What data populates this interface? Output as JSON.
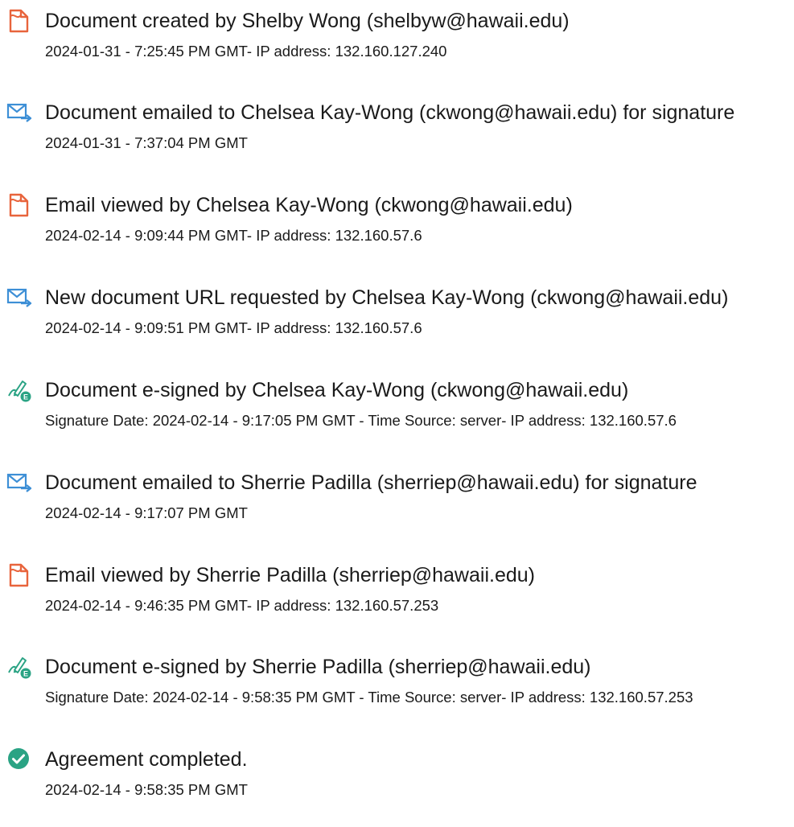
{
  "colors": {
    "doc_icon": "#e8643c",
    "email_icon": "#3d8fd6",
    "sign_icon": "#2aa384",
    "check_icon": "#2aa384",
    "text": "#1a1a1a"
  },
  "events": [
    {
      "icon": "document-icon",
      "title": "Document created by Shelby Wong (shelbyw@hawaii.edu)",
      "detail": "2024-01-31 - 7:25:45 PM GMT- IP address: 132.160.127.240"
    },
    {
      "icon": "email-sent-icon",
      "title": "Document emailed to Chelsea Kay-Wong (ckwong@hawaii.edu) for signature",
      "detail": "2024-01-31 - 7:37:04 PM GMT"
    },
    {
      "icon": "document-icon",
      "title": "Email viewed by Chelsea Kay-Wong (ckwong@hawaii.edu)",
      "detail": "2024-02-14 - 9:09:44 PM GMT- IP address: 132.160.57.6"
    },
    {
      "icon": "email-sent-icon",
      "title": "New document URL requested by Chelsea Kay-Wong (ckwong@hawaii.edu)",
      "detail": "2024-02-14 - 9:09:51 PM GMT- IP address: 132.160.57.6"
    },
    {
      "icon": "e-sign-icon",
      "title": "Document e-signed by Chelsea Kay-Wong (ckwong@hawaii.edu)",
      "detail": "Signature Date: 2024-02-14 - 9:17:05 PM GMT - Time Source: server- IP address: 132.160.57.6"
    },
    {
      "icon": "email-sent-icon",
      "title": "Document emailed to Sherrie Padilla (sherriep@hawaii.edu) for signature",
      "detail": "2024-02-14 - 9:17:07 PM GMT"
    },
    {
      "icon": "document-icon",
      "title": "Email viewed by Sherrie Padilla (sherriep@hawaii.edu)",
      "detail": "2024-02-14 - 9:46:35 PM GMT- IP address: 132.160.57.253"
    },
    {
      "icon": "e-sign-icon",
      "title": "Document e-signed by Sherrie Padilla (sherriep@hawaii.edu)",
      "detail": "Signature Date: 2024-02-14 - 9:58:35 PM GMT - Time Source: server- IP address: 132.160.57.253"
    },
    {
      "icon": "check-circle-icon",
      "title": "Agreement completed.",
      "detail": "2024-02-14 - 9:58:35 PM GMT"
    }
  ]
}
